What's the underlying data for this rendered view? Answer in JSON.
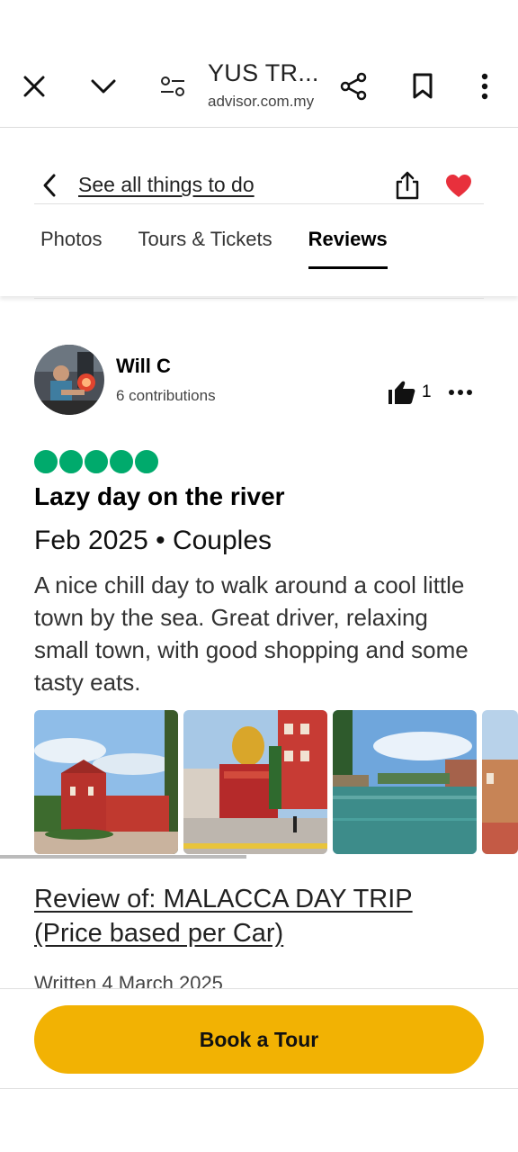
{
  "browser": {
    "title": "YUS TR...",
    "url": "advisor.com.my"
  },
  "header": {
    "back_link": "See all things to do",
    "tabs": [
      {
        "label": "Photos",
        "active": false
      },
      {
        "label": "Tours & Tickets",
        "active": false
      },
      {
        "label": "Reviews",
        "active": true
      }
    ],
    "heart_color": "#e8303c"
  },
  "review": {
    "user_name": "Will C",
    "contributions": "6 contributions",
    "helpful_votes": "1",
    "rating": 5,
    "rating_color": "#00aa6c",
    "title": "Lazy day on the river",
    "meta": "Feb 2025 • Couples",
    "body": "A nice chill day to walk around a cool little town by the sea. Great driver, relaxing small town, with good shopping and some tasty eats.",
    "review_of": "Review of: MALACCA DAY TRIP (Price based per Car)",
    "written": "Written 4 March 2025"
  },
  "cta": {
    "label": "Book a Tour",
    "color": "#f2b203"
  }
}
